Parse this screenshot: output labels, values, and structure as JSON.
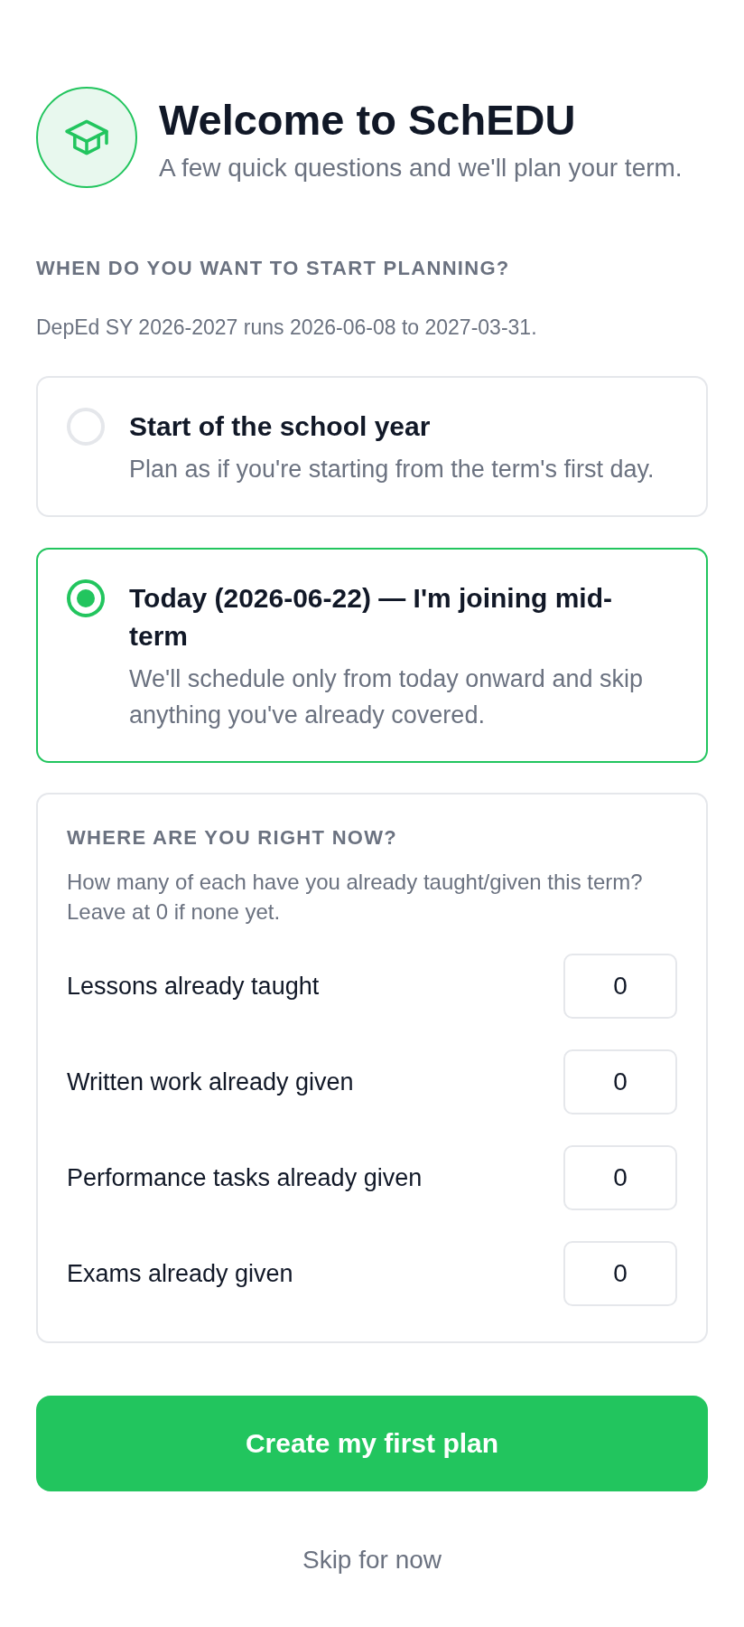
{
  "header": {
    "title": "Welcome to SchEDU",
    "subtitle": "A few quick questions and we'll plan your term."
  },
  "start_section": {
    "heading": "WHEN DO YOU WANT TO START PLANNING?",
    "note": "DepEd SY 2026-2027 runs 2026-06-08 to 2027-03-31.",
    "options": [
      {
        "title": "Start of the school year",
        "description": "Plan as if you're starting from the term's first day.",
        "selected": false
      },
      {
        "title": "Today (2026-06-22) — I'm joining mid-term",
        "description": "We'll schedule only from today onward and skip anything you've already covered.",
        "selected": true
      }
    ]
  },
  "progress_section": {
    "heading": "WHERE ARE YOU RIGHT NOW?",
    "hint": "How many of each have you already taught/given this term? Leave at 0 if none yet.",
    "fields": [
      {
        "label": "Lessons already taught",
        "value": "0"
      },
      {
        "label": "Written work already given",
        "value": "0"
      },
      {
        "label": "Performance tasks already given",
        "value": "0"
      },
      {
        "label": "Exams already given",
        "value": "0"
      }
    ]
  },
  "actions": {
    "primary_button": "Create my first plan",
    "skip_link": "Skip for now"
  }
}
